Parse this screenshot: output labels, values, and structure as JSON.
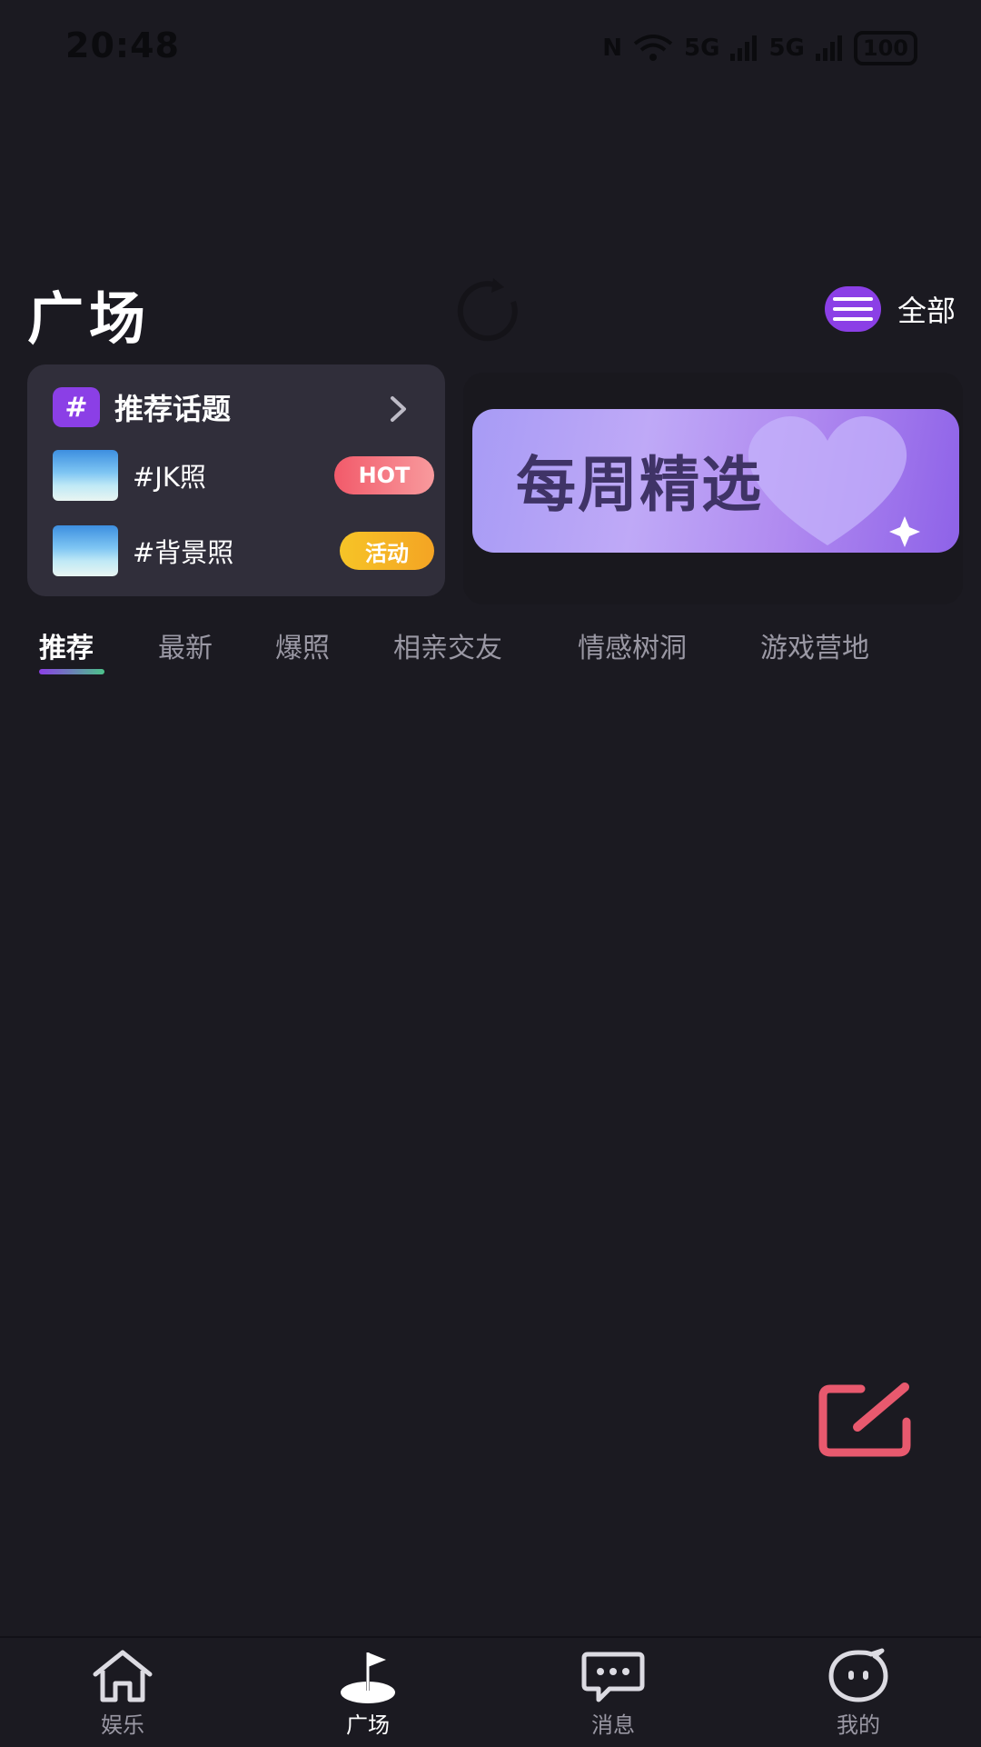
{
  "status_bar": {
    "time": "20:48",
    "net1": "5G",
    "net2": "5G",
    "battery": "100"
  },
  "header": {
    "title": "广场",
    "all_label": "全部"
  },
  "topics": {
    "title": "推荐话题",
    "hash": "#",
    "items": [
      {
        "name": "#JK照",
        "tag": "HOT"
      },
      {
        "name": "#背景照",
        "tag": "活动"
      }
    ]
  },
  "banner": {
    "text": "每周精选"
  },
  "tabs": [
    "推荐",
    "最新",
    "爆照",
    "相亲交友",
    "情感树洞",
    "游戏营地"
  ],
  "active_tab": "推荐",
  "bottom_nav": [
    {
      "label": "娱乐",
      "icon": "home-icon"
    },
    {
      "label": "广场",
      "icon": "plaza-flag-icon",
      "active": true
    },
    {
      "label": "消息",
      "icon": "message-icon"
    },
    {
      "label": "我的",
      "icon": "profile-face-icon"
    }
  ],
  "colors": {
    "background": "#1b1a21",
    "accent_purple": "#8b3fe6",
    "compose_pink": "#e8596e",
    "hot_red": "#f25a6a",
    "event_yellow": "#f6c427"
  }
}
